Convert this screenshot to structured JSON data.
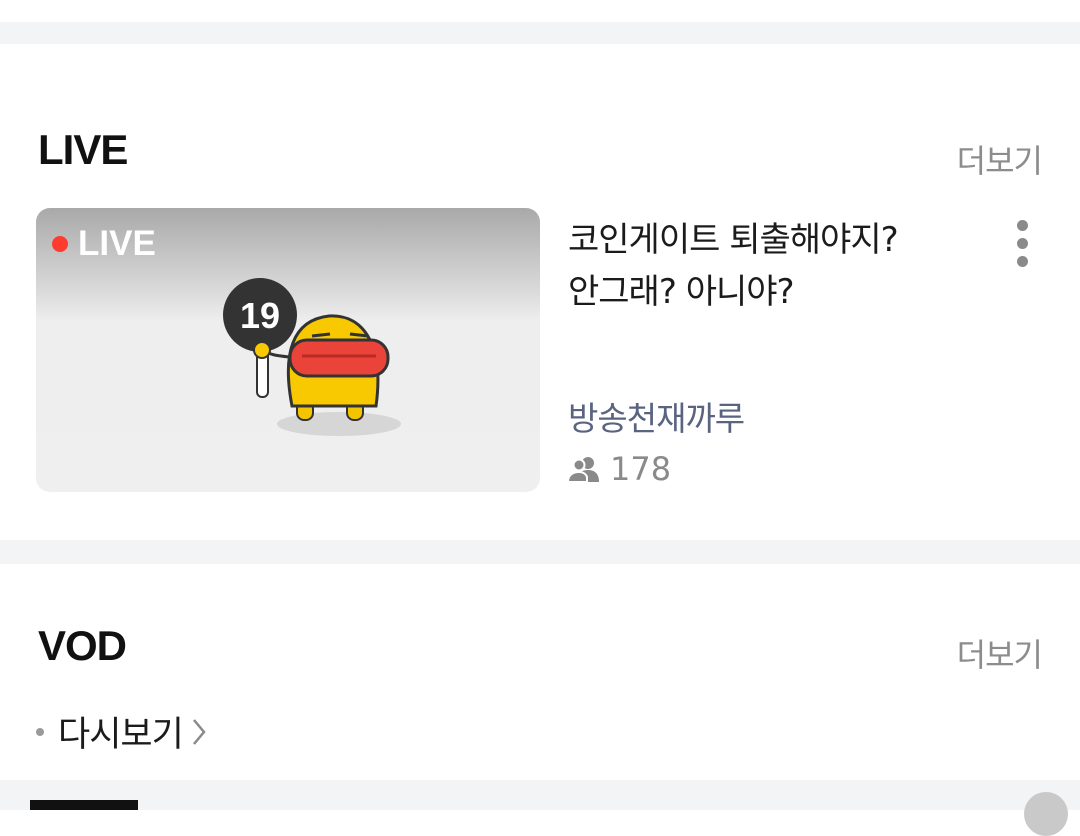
{
  "live_section": {
    "title": "LIVE",
    "more_label": "더보기",
    "card": {
      "badge": "LIVE",
      "age_rating": "19",
      "title_line1": "코인게이트 퇴출해야지?",
      "title_line2": "안그래? 아니야?",
      "channel": "방송천재까루",
      "viewer_count": "178",
      "viewer_icon": "people-icon",
      "menu_icon": "kebab-menu-icon"
    }
  },
  "vod_section": {
    "title": "VOD",
    "more_label": "더보기",
    "replay_label": "다시보기",
    "replay_icon": "chevron-right-icon"
  },
  "colors": {
    "band": "#f3f4f6",
    "live_dot": "#ff3b30",
    "channel": "#5a6480",
    "muted": "#8c8c8c"
  }
}
